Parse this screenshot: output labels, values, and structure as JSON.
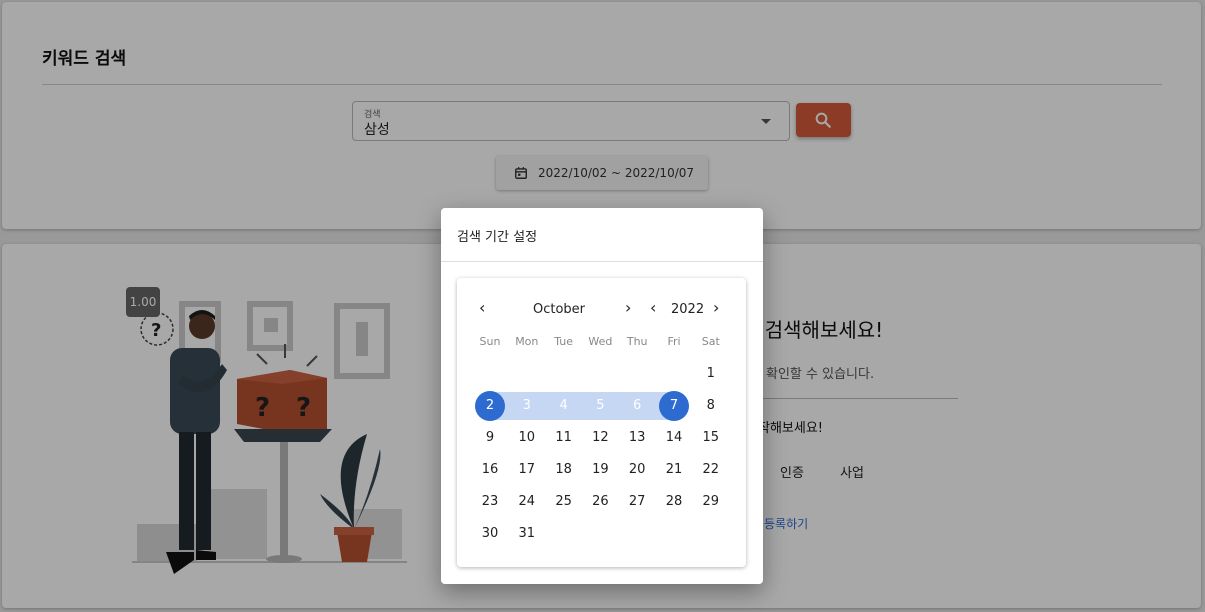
{
  "search_card": {
    "title": "키워드 검색",
    "select_label": "검색",
    "select_value": "삼성",
    "date_range": "2022/10/02 ~ 2022/10/07"
  },
  "result_card": {
    "zoom": "1.00",
    "hint_title": "를 검색해보세요!",
    "hint_sub": "확인할 수 있습니다.",
    "hint_body": "작해보세요!",
    "chips": [
      "인증",
      "사업"
    ],
    "link": "등록하기"
  },
  "dialog": {
    "title": "검색 기간 설정",
    "month": "October",
    "year": "2022",
    "weekdays": [
      "Sun",
      "Mon",
      "Tue",
      "Wed",
      "Thu",
      "Fri",
      "Sat"
    ],
    "days": [
      "1",
      "2",
      "3",
      "4",
      "5",
      "6",
      "7",
      "8",
      "9",
      "10",
      "11",
      "12",
      "13",
      "14",
      "15",
      "16",
      "17",
      "18",
      "19",
      "20",
      "21",
      "22",
      "23",
      "24",
      "25",
      "26",
      "27",
      "28",
      "29",
      "30",
      "31"
    ],
    "first_weekday": 6,
    "range_start": 2,
    "range_end": 7
  },
  "colors": {
    "accent": "#2e6bd0",
    "range_fill": "#c5d7f2",
    "search_button": "#d45a3a"
  },
  "icons": {
    "search": "search-icon",
    "calendar": "calendar-icon",
    "prev": "chevron-left-icon",
    "next": "chevron-right-icon",
    "dropdown": "caret-down-icon"
  }
}
